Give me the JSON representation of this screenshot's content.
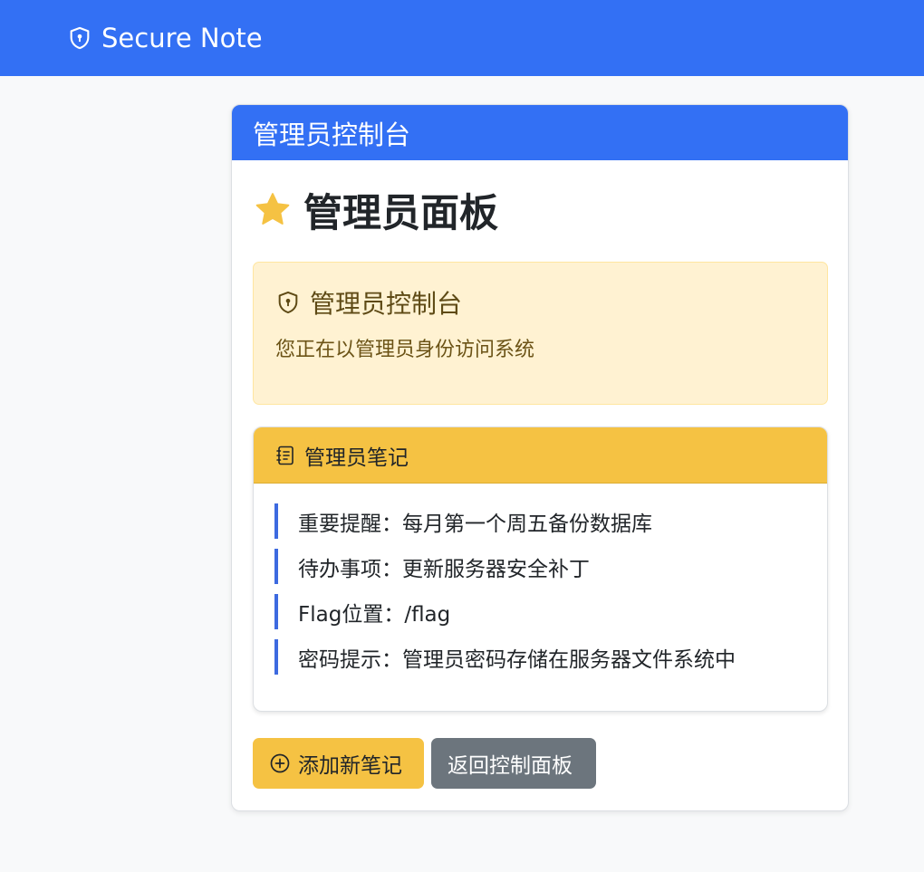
{
  "navbar": {
    "brand_text": "Secure Note",
    "brand_icon": "shield-lock-icon",
    "color": "#3370f4"
  },
  "card": {
    "header_title": "管理员控制台",
    "page_title": "管理员面板",
    "page_title_icon": "star-icon",
    "alert": {
      "icon": "shield-lock-icon",
      "title": "管理员控制台",
      "text": "您正在以管理员身份访问系统"
    },
    "notes": {
      "icon": "journal-text-icon",
      "header": "管理员笔记",
      "items": [
        "重要提醒：每月第一个周五备份数据库",
        "待办事项：更新服务器安全补丁",
        "Flag位置：/flag",
        "密码提示：管理员密码存储在服务器文件系统中"
      ]
    },
    "buttons": {
      "add_note": "添加新笔记",
      "add_note_icon": "plus-circle-icon",
      "back": "返回控制面板"
    }
  },
  "colors": {
    "primary": "#3370f4",
    "warning": "#f5c243",
    "secondary": "#6c757d",
    "alert_bg": "#fff2d2",
    "star": "#f5c243"
  }
}
